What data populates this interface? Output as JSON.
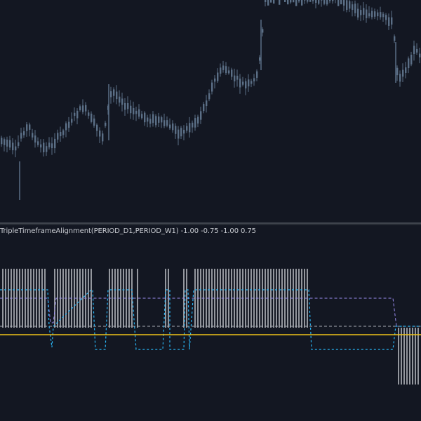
{
  "indicator": {
    "label": "TripleTimeframeAlignment(PERIOD_D1,PERIOD_W1) -1.00 -0.75 -1.00 0.75"
  },
  "colors": {
    "background": "#131722",
    "candle": "#5b6f86",
    "separator": "#6b7178",
    "histogram": "#b4b7bd",
    "line_cyan": "#29b6f6",
    "line_violet": "#9b8cf0",
    "line_gray": "#a9aeb6",
    "zero_line": "#f0c419"
  },
  "icons": {
    "pane_separator": "horizontal-divider"
  }
}
